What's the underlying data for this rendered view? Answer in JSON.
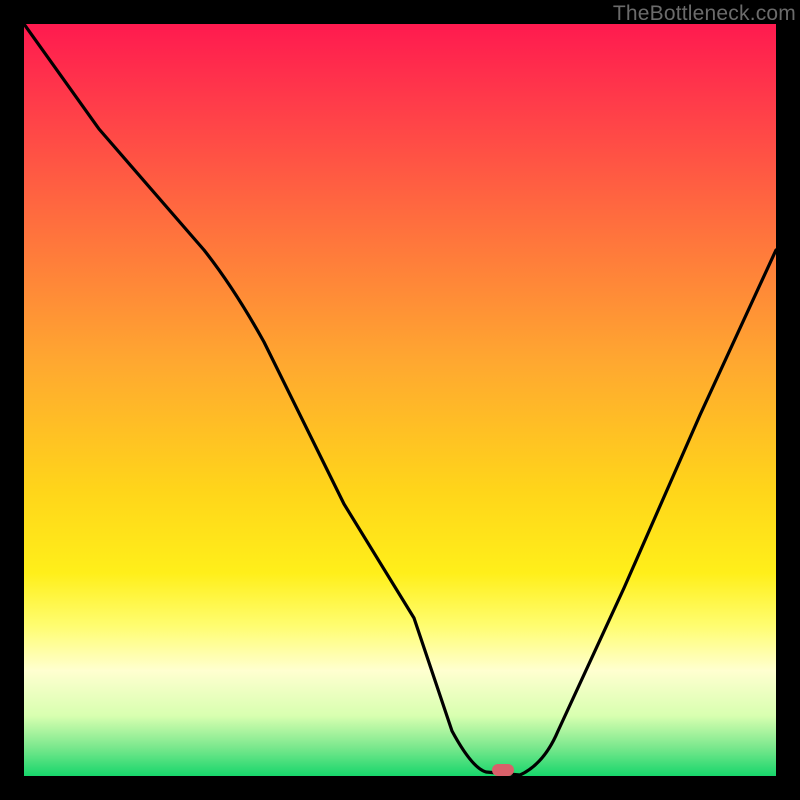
{
  "watermark": "TheBottleneck.com",
  "chart_data": {
    "type": "line",
    "title": "",
    "xlabel": "",
    "ylabel": "",
    "xlim": [
      0,
      100
    ],
    "ylim": [
      0,
      100
    ],
    "grid": false,
    "series": [
      {
        "name": "curve",
        "x": [
          0,
          10,
          24,
          40,
          52,
          57,
          60,
          63,
          66,
          71,
          80,
          90,
          100
        ],
        "values": [
          100,
          86,
          70,
          45,
          21,
          6,
          1,
          0,
          0,
          6,
          25,
          48,
          70
        ]
      }
    ],
    "marker": {
      "x": 64.5,
      "y": 0
    },
    "colors": {
      "curve": "#000000",
      "marker": "#d9606a",
      "gradient_stops": [
        {
          "pos": 0.0,
          "color": "#ff1a4f"
        },
        {
          "pos": 0.45,
          "color": "#ffa830"
        },
        {
          "pos": 0.73,
          "color": "#ffef1a"
        },
        {
          "pos": 1.0,
          "color": "#17d66b"
        }
      ]
    }
  }
}
